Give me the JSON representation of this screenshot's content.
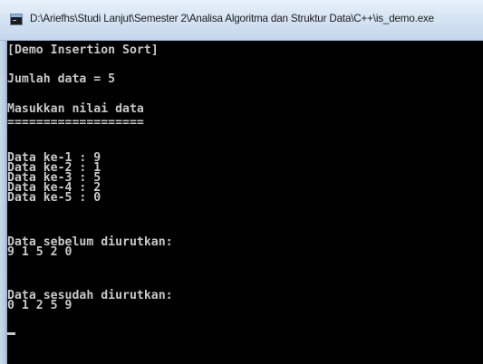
{
  "window": {
    "title": "D:\\Ariefhs\\Studi Lanjut\\Semester 2\\Analisa Algoritma dan Struktur Data\\C++\\is_demo.exe",
    "icon": "console-app-icon"
  },
  "console": {
    "header": "[Demo Insertion Sort]",
    "count_line": "Jumlah data = 5",
    "prompt": "Masukkan nilai data",
    "separator": "===================",
    "entries": [
      "Data ke-1 : 9",
      "Data ke-2 : 1",
      "Data ke-3 : 5",
      "Data ke-4 : 2",
      "Data ke-5 : 0"
    ],
    "before_label": "Data sebelum diurutkan:",
    "before_values": "9 1 5 2 0",
    "after_label": "Data sesudah diurutkan:",
    "after_values": "0 1 2 5 9"
  }
}
